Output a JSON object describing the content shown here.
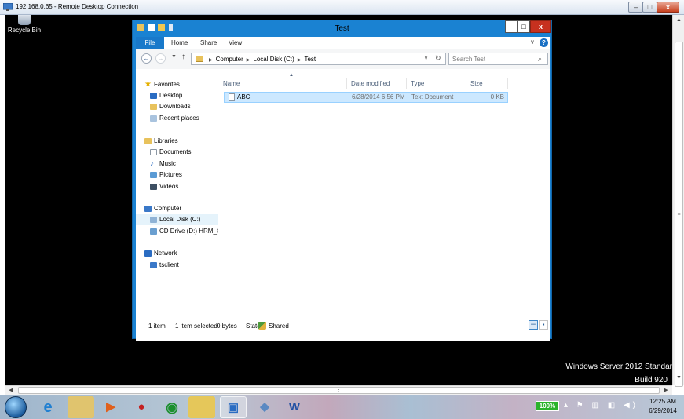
{
  "rdp": {
    "title": "192.168.0.65 - Remote Desktop Connection",
    "min_glyph": "–",
    "max_glyph": "□",
    "close_glyph": "x"
  },
  "desktop": {
    "recycle_bin": "Recycle Bin",
    "watermark_line1": "Windows Server 2012 Standar",
    "watermark_line2": "Build 920"
  },
  "explorer": {
    "title": "Test",
    "min_glyph": "–",
    "max_glyph": "□",
    "close_glyph": "x",
    "ribbon_tabs": [
      "File",
      "Home",
      "Share",
      "View"
    ],
    "breadcrumb": [
      "Computer",
      "Local Disk (C:)",
      "Test"
    ],
    "breadcrumb_sep": "▶",
    "search_placeholder": "Search Test",
    "nav": {
      "favorites": "Favorites",
      "desktop": "Desktop",
      "downloads": "Downloads",
      "recent": "Recent places",
      "libraries": "Libraries",
      "documents": "Documents",
      "music": "Music",
      "pictures": "Pictures",
      "videos": "Videos",
      "computer": "Computer",
      "local_disk": "Local Disk (C:)",
      "cd_drive": "CD Drive (D:) HRM_S",
      "network": "Network",
      "tsclient": "tsclient"
    },
    "columns": [
      "Name",
      "Date modified",
      "Type",
      "Size"
    ],
    "files": [
      {
        "name": "ABC",
        "date": "6/28/2014 6:56 PM",
        "type": "Text Document",
        "size": "0 KB"
      }
    ],
    "status": {
      "items": "1 item",
      "selected": "1 item selected",
      "bytes": "0 bytes",
      "state_label": "State:",
      "state_value": "Shared"
    }
  },
  "taskbar": {
    "battery": "100%",
    "time": "12:25 AM",
    "date": "6/29/2014"
  },
  "colors": {
    "explorer_frame": "#1a82d2",
    "selection": "#cce8ff",
    "close_red": "#c7311f"
  }
}
